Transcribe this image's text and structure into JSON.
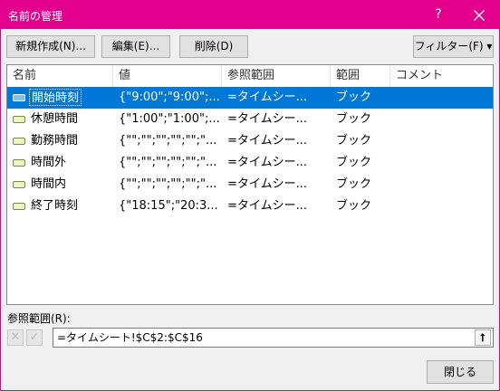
{
  "window": {
    "title": "名前の管理",
    "help_label": "?",
    "close_label": "✕",
    "accent_color": "#e3008c"
  },
  "toolbar": {
    "new_label": "新規作成(N)...",
    "edit_label": "編集(E)...",
    "delete_label": "削除(D)",
    "filter_label": "フィルター(F) ▾"
  },
  "list": {
    "columns": [
      "名前",
      "値",
      "参照範囲",
      "範囲",
      "コメント"
    ],
    "rows": [
      {
        "name": "開始時刻",
        "value": "{\"9:00\";\"9:00\";...",
        "ref": "=タイムシー...",
        "scope": "ブック",
        "comment": "",
        "selected": true
      },
      {
        "name": "休憩時間",
        "value": "{\"1:00\";\"1:00\";...",
        "ref": "=タイムシー...",
        "scope": "ブック",
        "comment": "",
        "selected": false
      },
      {
        "name": "勤務時間",
        "value": "{\"\";\"\";\"\";\"\";\"\";\"...",
        "ref": "=タイムシー...",
        "scope": "ブック",
        "comment": "",
        "selected": false
      },
      {
        "name": "時間外",
        "value": "{\"\";\"\";\"\";\"\";\"\";\"...",
        "ref": "=タイムシー...",
        "scope": "ブック",
        "comment": "",
        "selected": false
      },
      {
        "name": "時間内",
        "value": "{\"\";\"\";\"\";\"\";\"\";\"...",
        "ref": "=タイムシー...",
        "scope": "ブック",
        "comment": "",
        "selected": false
      },
      {
        "name": "終了時刻",
        "value": "{\"18:15\";\"20:3...",
        "ref": "=タイムシー...",
        "scope": "ブック",
        "comment": "",
        "selected": false
      }
    ]
  },
  "reference": {
    "label": "参照範囲(R):",
    "value": "=タイムシート!$C$2:$C$16",
    "cancel_icon": "✕",
    "confirm_icon": "✓",
    "collapse_icon": "⭡"
  },
  "footer": {
    "close_label": "閉じる"
  }
}
